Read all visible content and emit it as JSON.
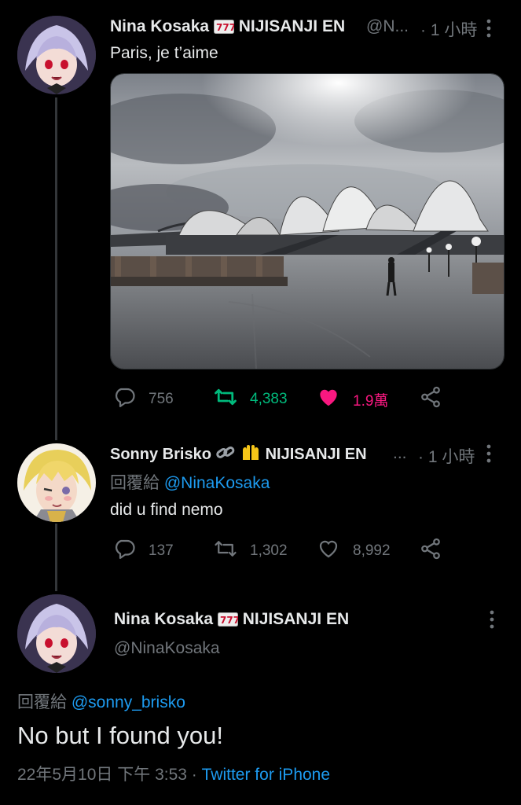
{
  "tweet1": {
    "name": "Nina Kosaka",
    "org": "NIJISANJI EN",
    "handle": "@N...",
    "time": "· 1 小時",
    "text": "Paris, je t’aime",
    "stats": {
      "replies": "756",
      "retweets": "4,383",
      "likes": "1.9萬"
    }
  },
  "tweet2": {
    "name": "Sonny Brisko",
    "org": "NIJISANJI EN",
    "ellipsis": "...",
    "time": "· 1 小時",
    "reply_prefix": "回覆給",
    "reply_mention": "@NinaKosaka",
    "text": "did u find nemo",
    "stats": {
      "replies": "137",
      "retweets": "1,302",
      "likes": "8,992"
    }
  },
  "main_tweet": {
    "name": "Nina Kosaka",
    "org": "NIJISANJI EN",
    "handle": "@NinaKosaka",
    "reply_prefix": "回覆給",
    "reply_mention": "@sonny_brisko",
    "text": "No but I found you!",
    "timestamp": "22年5月10日 下午 3:53",
    "separator": "·",
    "source": "Twitter for iPhone"
  },
  "colors": {
    "background": "#000000",
    "text": "#e7e9ea",
    "muted": "#71767b",
    "link": "#1d9bf0",
    "retweet_active": "#00ba7c",
    "like_active": "#f91880"
  },
  "icons": [
    "reply-icon",
    "retweet-icon",
    "like-icon",
    "share-icon",
    "more-icon",
    "slot-machine-emoji",
    "link-emoji",
    "raised-hands-emoji"
  ]
}
